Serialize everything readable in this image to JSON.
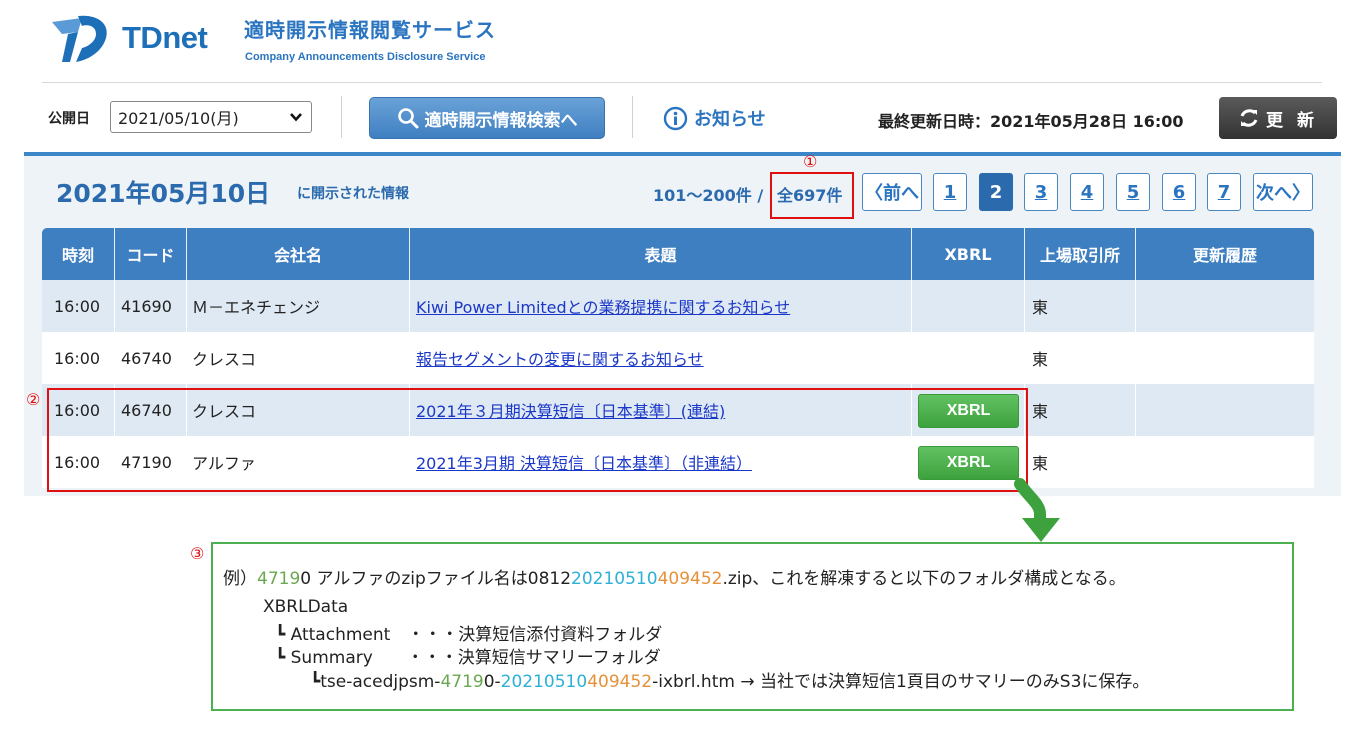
{
  "header": {
    "logo_text": "TDnet",
    "service_title": "適時開示情報閲覧サービス",
    "service_subtitle": "Company Announcements Disclosure Service"
  },
  "toolbar": {
    "date_label": "公開日",
    "date_value": "2021/05/10(月)",
    "search_label": "適時開示情報検索へ",
    "notice_label": "お知らせ",
    "last_update": "最終更新日時：2021年05月28日 16:00",
    "refresh_label": "更 新"
  },
  "main": {
    "date_title": "2021年05月10日",
    "date_sub": "に開示された情報",
    "range_text": "101～200件 /",
    "total_text": "全697件",
    "pager": {
      "prev": "〈前へ",
      "pages": [
        "1",
        "2",
        "3",
        "4",
        "5",
        "6",
        "7"
      ],
      "active": "2",
      "next": "次へ〉"
    }
  },
  "annotations": {
    "c1": "①",
    "c2": "②",
    "c3": "③"
  },
  "table": {
    "headers": [
      "時刻",
      "コード",
      "会社名",
      "表題",
      "XBRL",
      "上場取引所",
      "更新履歴"
    ],
    "rows": [
      {
        "time": "16:00",
        "code": "41690",
        "company": "Ｍ－エネチェンジ",
        "title": "Kiwi Power Limitedとの業務提携に関するお知らせ",
        "xbrl": "",
        "exchange": "東",
        "history": ""
      },
      {
        "time": "16:00",
        "code": "46740",
        "company": "クレスコ",
        "title": "報告セグメントの変更に関するお知らせ",
        "xbrl": "",
        "exchange": "東",
        "history": ""
      },
      {
        "time": "16:00",
        "code": "46740",
        "company": "クレスコ",
        "title": "2021年３月期決算短信〔日本基準〕(連結)",
        "xbrl": "XBRL",
        "exchange": "東",
        "history": ""
      },
      {
        "time": "16:00",
        "code": "47190",
        "company": "アルファ",
        "title": "2021年3月期 決算短信〔日本基準〕（非連結）",
        "xbrl": "XBRL",
        "exchange": "東",
        "history": ""
      }
    ]
  },
  "example": {
    "line1": {
      "prefix": "例）",
      "code_a": "4719",
      "code_b": "0 アルファのzipファイル名は0812",
      "date": "20210510",
      "seq": "409452",
      "suffix": ".zip、これを解凍すると以下のフォルダ構成となる。"
    },
    "folder_root": "XBRLData",
    "attachment": "┗ Attachment　・・・決算短信添付資料フォルダ",
    "summary": "┗ Summary　　・・・決算短信サマリーフォルダ",
    "file_line": {
      "prefix": "┗tse-acedjpsm-",
      "code_a": "4719",
      "code_b": "0-",
      "date": "20210510",
      "seq": "409452",
      "suffix": "-ixbrl.htm → 当社では決算短信1頁目のサマリーのみS3に保存。"
    }
  },
  "colors": {
    "brand_blue": "#2a74c0",
    "header_blue": "#3e7fc1",
    "xbrl_green": "#3da23d",
    "highlight_red": "#e01010",
    "code_green": "#6aa84f",
    "date_blue": "#2cb0d8",
    "seq_orange": "#e69138"
  },
  "icons": [
    "tdnet-logo-icon",
    "chevron-down-icon",
    "search-icon",
    "info-icon",
    "refresh-icon",
    "down-arrow-icon"
  ]
}
